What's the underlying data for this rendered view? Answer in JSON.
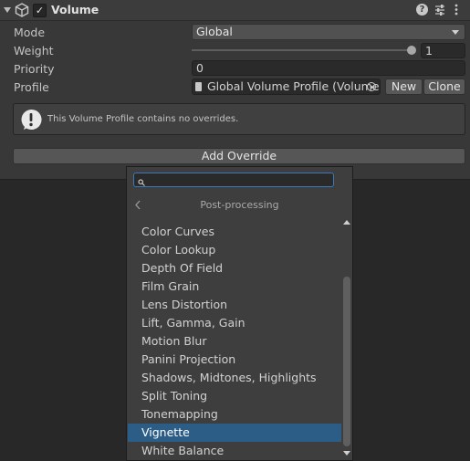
{
  "component": {
    "title": "Volume",
    "enabled_check": "✓"
  },
  "properties": {
    "mode": {
      "label": "Mode",
      "value": "Global"
    },
    "weight": {
      "label": "Weight",
      "value": "1",
      "slider_fraction": 1.0
    },
    "priority": {
      "label": "Priority",
      "value": "0"
    },
    "profile": {
      "label": "Profile",
      "value": "Global Volume Profile (Volume",
      "new_label": "New",
      "clone_label": "Clone"
    }
  },
  "notice": {
    "text": "This Volume Profile contains no overrides."
  },
  "add_override": {
    "label": "Add Override"
  },
  "popup": {
    "search_value": "",
    "category": "Post-processing",
    "items": [
      "Color Curves",
      "Color Lookup",
      "Depth Of Field",
      "Film Grain",
      "Lens Distortion",
      "Lift, Gamma, Gain",
      "Motion Blur",
      "Panini Projection",
      "Shadows, Midtones, Highlights",
      "Split Toning",
      "Tonemapping",
      "Vignette",
      "White Balance"
    ],
    "selected_item": "Vignette"
  }
}
